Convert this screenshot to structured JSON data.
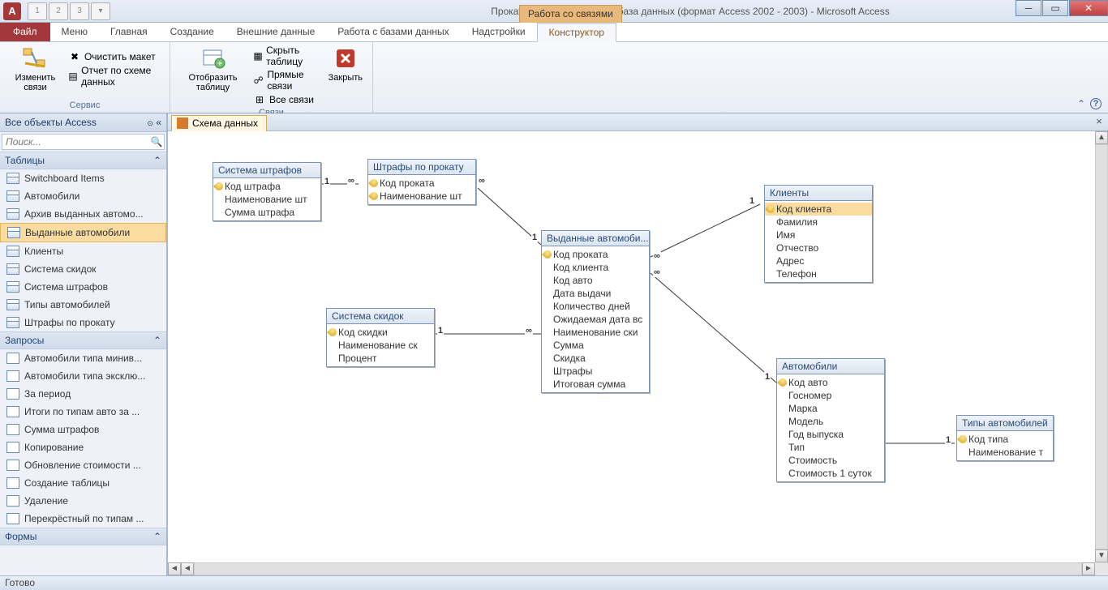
{
  "window": {
    "title": "Прокат автомобилей 2003 : база данных (формат Access 2002 - 2003)  -  Microsoft Access"
  },
  "context_tab_group": "Работа со связями",
  "qat": [
    "1",
    "2",
    "3"
  ],
  "tabs": {
    "file": "Файл",
    "items": [
      {
        "label": "Меню",
        "key": "Q"
      },
      {
        "label": "Главная",
        "key": "Я"
      },
      {
        "label": "Создание",
        "key": "С"
      },
      {
        "label": "Внешние данные",
        "key": "Ш"
      },
      {
        "label": "Работа с базами данных",
        "key": "А"
      },
      {
        "label": "Надстройки",
        "key": "Н"
      },
      {
        "label": "Конструктор",
        "key": "БС",
        "context": true
      }
    ],
    "file_key": "Ф"
  },
  "ribbon": {
    "group_service": "Сервис",
    "group_links": "Связи",
    "edit_links": "Изменить связи",
    "clear_layout": "Очистить макет",
    "schema_report": "Отчет по схеме данных",
    "show_table": "Отобразить таблицу",
    "hide_table": "Скрыть таблицу",
    "direct_links": "Прямые связи",
    "all_links": "Все связи",
    "close": "Закрыть"
  },
  "nav": {
    "header": "Все объекты Access",
    "search_placeholder": "Поиск...",
    "group_tables": "Таблицы",
    "group_queries": "Запросы",
    "group_forms": "Формы",
    "tables": [
      "Switchboard Items",
      "Автомобили",
      "Архив выданных автомо...",
      "Выданные автомобили",
      "Клиенты",
      "Система скидок",
      "Система штрафов",
      "Типы автомобилей",
      "Штрафы по прокату"
    ],
    "tables_selected": 3,
    "queries": [
      "Автомобили типа минив...",
      "Автомобили типа эксклю...",
      "За период",
      "Итоги по типам авто за ...",
      "Сумма штрафов",
      "Копирование",
      "Обновление стоимости ...",
      "Создание таблицы",
      "Удаление",
      "Перекрёстный по типам ..."
    ]
  },
  "doc": {
    "tab": "Схема данных"
  },
  "tables": {
    "t1": {
      "title": "Система штрафов",
      "fields": [
        {
          "n": "Код штрафа",
          "pk": true
        },
        {
          "n": "Наименование шт"
        },
        {
          "n": "Сумма штрафа"
        }
      ]
    },
    "t2": {
      "title": "Штрафы по прокату",
      "fields": [
        {
          "n": "Код проката",
          "pk": true
        },
        {
          "n": "Наименование шт",
          "pk": true
        }
      ]
    },
    "t3": {
      "title": "Система скидок",
      "fields": [
        {
          "n": "Код скидки",
          "pk": true
        },
        {
          "n": "Наименование ск"
        },
        {
          "n": "Процент"
        }
      ]
    },
    "t4": {
      "title": "Выданные автомоби...",
      "fields": [
        {
          "n": "Код проката",
          "pk": true
        },
        {
          "n": "Код клиента"
        },
        {
          "n": "Код авто"
        },
        {
          "n": "Дата выдачи"
        },
        {
          "n": "Количество дней"
        },
        {
          "n": "Ожидаемая дата вс"
        },
        {
          "n": "Наименование ски"
        },
        {
          "n": "Сумма"
        },
        {
          "n": "Скидка"
        },
        {
          "n": "Штрафы"
        },
        {
          "n": "Итоговая сумма"
        }
      ]
    },
    "t5": {
      "title": "Клиенты",
      "fields": [
        {
          "n": "Код клиента",
          "pk": true,
          "sel": true
        },
        {
          "n": "Фамилия"
        },
        {
          "n": "Имя"
        },
        {
          "n": "Отчество"
        },
        {
          "n": "Адрес"
        },
        {
          "n": "Телефон"
        }
      ]
    },
    "t6": {
      "title": "Автомобили",
      "fields": [
        {
          "n": "Код авто",
          "pk": true
        },
        {
          "n": "Госномер"
        },
        {
          "n": "Марка"
        },
        {
          "n": "Модель"
        },
        {
          "n": "Год выпуска"
        },
        {
          "n": "Тип"
        },
        {
          "n": "Стоимость"
        },
        {
          "n": "Стоимость 1 суток"
        }
      ]
    },
    "t7": {
      "title": "Типы автомобилей",
      "fields": [
        {
          "n": "Код типа",
          "pk": true
        },
        {
          "n": "Наименование т"
        }
      ]
    }
  },
  "rel_labels": {
    "one": "1",
    "many": "∞"
  },
  "status": "Готово"
}
